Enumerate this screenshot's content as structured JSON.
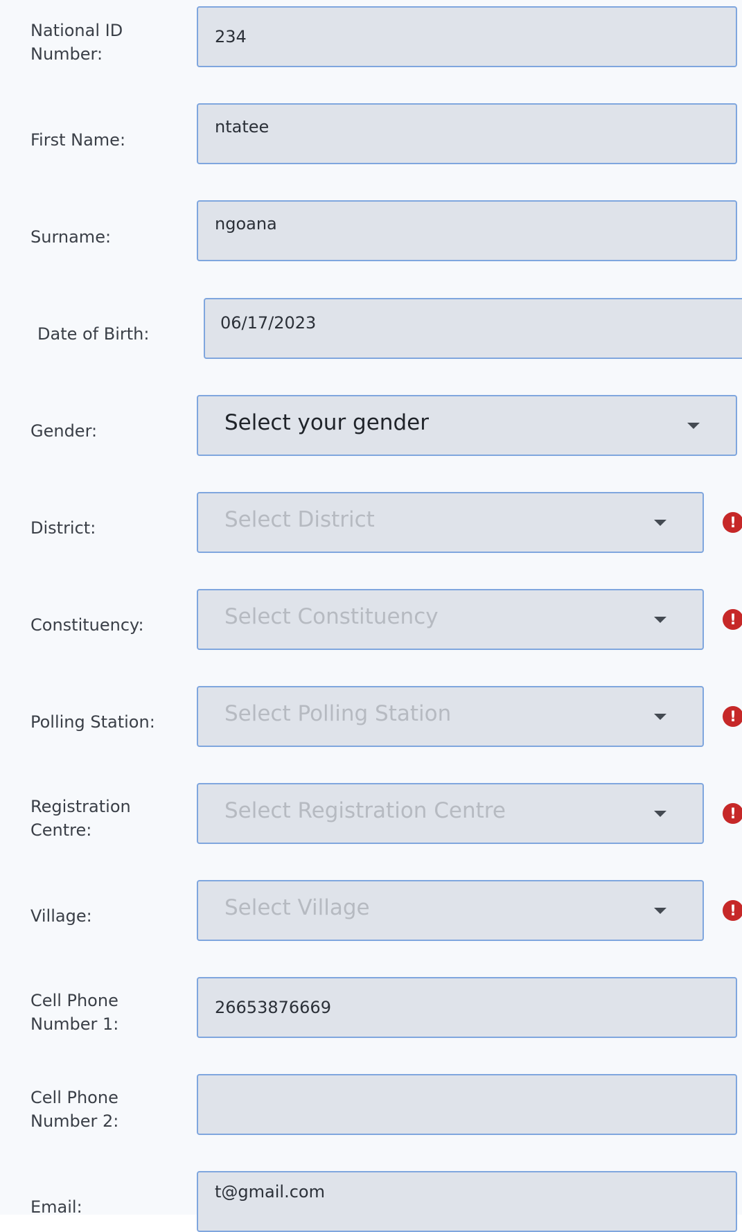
{
  "form": {
    "national_id": {
      "label": "National ID\nNumber:",
      "value": "234"
    },
    "first_name": {
      "label": "First Name:",
      "value": "ntatee"
    },
    "surname": {
      "label": "Surname:",
      "value": "ngoana"
    },
    "dob": {
      "label": "Date of Birth:",
      "value": "06/17/2023"
    },
    "gender": {
      "label": "Gender:",
      "value": "Select your gender"
    },
    "district": {
      "label": "District:",
      "placeholder": "Select District",
      "error_icon": "exclamation-icon"
    },
    "constituency": {
      "label": "Constituency:",
      "placeholder": "Select Constituency",
      "error_icon": "exclamation-icon"
    },
    "polling_station": {
      "label": "Polling Station:",
      "placeholder": "Select Polling Station",
      "error_icon": "exclamation-icon"
    },
    "registration_centre": {
      "label": "Registration\nCentre:",
      "placeholder": "Select Registration Centre",
      "error_icon": "exclamation-icon"
    },
    "village": {
      "label": "Village:",
      "placeholder": "Select Village",
      "error_icon": "exclamation-icon"
    },
    "cell_phone_1": {
      "label": "Cell Phone\nNumber 1:",
      "value": "26653876669"
    },
    "cell_phone_2": {
      "label": "Cell Phone\nNumber 2:",
      "value": ""
    },
    "email": {
      "label": "Email:",
      "value": "t@gmail.com"
    }
  },
  "error_glyph": "!",
  "colors": {
    "field_bg": "#dfe3ea",
    "field_border": "#7fa6de",
    "error": "#c62828",
    "placeholder": "#b6bac1"
  }
}
